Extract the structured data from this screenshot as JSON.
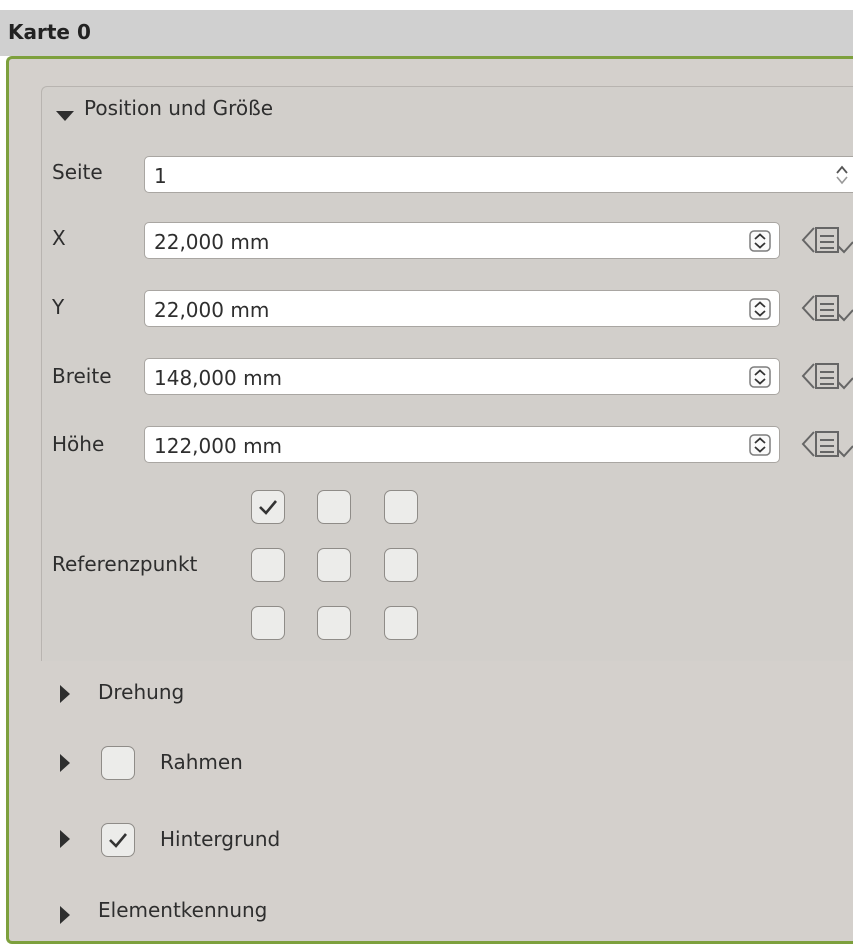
{
  "header": {
    "title": "Karte 0"
  },
  "position_group": {
    "title": "Position und Größe",
    "seite": {
      "label": "Seite",
      "value": "1"
    },
    "x": {
      "label": "X",
      "value": "22,000 mm"
    },
    "y": {
      "label": "Y",
      "value": "22,000 mm"
    },
    "breite": {
      "label": "Breite",
      "value": "148,000 mm"
    },
    "hoehe": {
      "label": "Höhe",
      "value": "122,000 mm"
    },
    "referenzpunkt": {
      "label": "Referenzpunkt",
      "checked": [
        true,
        false,
        false,
        false,
        false,
        false,
        false,
        false,
        false
      ]
    }
  },
  "sections": {
    "drehung": {
      "label": "Drehung"
    },
    "rahmen": {
      "label": "Rahmen",
      "checked": false
    },
    "hintergrund": {
      "label": "Hintergrund",
      "checked": true
    },
    "elementkennung": {
      "label": "Elementkennung"
    }
  },
  "icons": {
    "collapse": "triangle-down-icon",
    "expand": "triangle-right-icon",
    "spin": "spin-arrows-icon",
    "data_defined": "data-defined-override-icon",
    "check": "checkmark-icon"
  },
  "colors": {
    "panel_border": "#7da03d",
    "panel_bg": "#d4d0cc",
    "header_bg": "#d0d0d0"
  }
}
